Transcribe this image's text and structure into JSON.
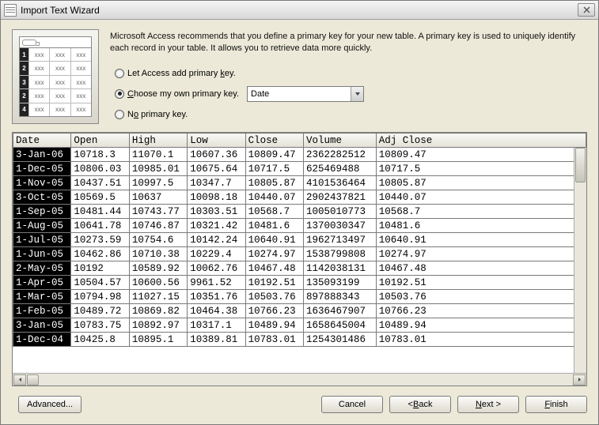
{
  "title": "Import Text Wizard",
  "description": "Microsoft Access recommends that you define a primary key for your new table. A primary key is used to uniquely identify each record in your table. It allows you to retrieve data more quickly.",
  "radios": {
    "let_access": "Let Access add primary key.",
    "choose_own": "Choose my own primary key.",
    "no_key": "No primary key."
  },
  "combo_value": "Date",
  "columns": [
    "Date",
    "Open",
    "High",
    "Low",
    "Close",
    "Volume",
    "Adj Close"
  ],
  "rows": [
    [
      "3-Jan-06",
      "10718.3",
      "11070.1",
      "10607.36",
      "10809.47",
      "2362282512",
      "10809.47"
    ],
    [
      "1-Dec-05",
      "10806.03",
      "10985.01",
      "10675.64",
      "10717.5",
      "625469488",
      "10717.5"
    ],
    [
      "1-Nov-05",
      "10437.51",
      "10997.5",
      "10347.7",
      "10805.87",
      "4101536464",
      "10805.87"
    ],
    [
      "3-Oct-05",
      "10569.5",
      "10637",
      "10098.18",
      "10440.07",
      "2902437821",
      "10440.07"
    ],
    [
      "1-Sep-05",
      "10481.44",
      "10743.77",
      "10303.51",
      "10568.7",
      "1005010773",
      "10568.7"
    ],
    [
      "1-Aug-05",
      "10641.78",
      "10746.87",
      "10321.42",
      "10481.6",
      "1370030347",
      "10481.6"
    ],
    [
      "1-Jul-05",
      "10273.59",
      "10754.6",
      "10142.24",
      "10640.91",
      "1962713497",
      "10640.91"
    ],
    [
      "1-Jun-05",
      "10462.86",
      "10710.38",
      "10229.4",
      "10274.97",
      "1538799808",
      "10274.97"
    ],
    [
      "2-May-05",
      "10192",
      "10589.92",
      "10062.76",
      "10467.48",
      "1142038131",
      "10467.48"
    ],
    [
      "1-Apr-05",
      "10504.57",
      "10600.56",
      "9961.52",
      "10192.51",
      "135093199",
      "10192.51"
    ],
    [
      "1-Mar-05",
      "10794.98",
      "11027.15",
      "10351.76",
      "10503.76",
      "897888343",
      "10503.76"
    ],
    [
      "1-Feb-05",
      "10489.72",
      "10869.82",
      "10464.38",
      "10766.23",
      "1636467907",
      "10766.23"
    ],
    [
      "3-Jan-05",
      "10783.75",
      "10892.97",
      "10317.1",
      "10489.94",
      "1658645004",
      "10489.94"
    ],
    [
      "1-Dec-04",
      "10425.8",
      "10895.1",
      "10389.81",
      "10783.01",
      "1254301486",
      "10783.01"
    ]
  ],
  "buttons": {
    "advanced": "Advanced...",
    "cancel": "Cancel",
    "back": "< Back",
    "next": "Next >",
    "finish": "Finish"
  }
}
